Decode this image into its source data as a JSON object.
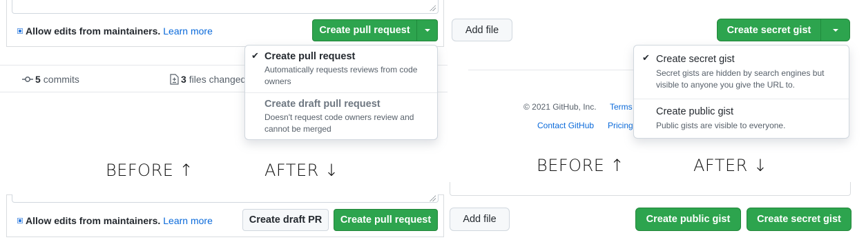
{
  "captions": {
    "left_before": "BEFORE ↑",
    "left_after": "AFTER ↓",
    "right_before": "BEFORE ↑",
    "right_after": "AFTER ↓"
  },
  "pr_before": {
    "allow_edits_label": "Allow edits from maintainers.",
    "learn_more": "Learn more",
    "create_button": "Create pull request",
    "menu": {
      "items": [
        {
          "title": "Create pull request",
          "description": "Automatically requests reviews from code owners",
          "selected": true
        },
        {
          "title": "Create draft pull request",
          "description": "Doesn't request code owners review and cannot be merged",
          "selected": false
        }
      ]
    },
    "stats": {
      "commits_count": "5",
      "commits_label": "commits",
      "files_count": "3",
      "files_label": "files changed"
    }
  },
  "pr_after": {
    "allow_edits_label": "Allow edits from maintainers.",
    "learn_more": "Learn more",
    "draft_button": "Create draft PR",
    "create_button": "Create pull request"
  },
  "gist_before": {
    "add_file": "Add file",
    "create_button": "Create secret gist",
    "menu": {
      "items": [
        {
          "title": "Create secret gist",
          "description": "Secret gists are hidden by search engines but visible to anyone you give the URL to.",
          "selected": true
        },
        {
          "title": "Create public gist",
          "description": "Public gists are visible to everyone.",
          "selected": false
        }
      ]
    },
    "footer": {
      "copyright": "© 2021 GitHub, Inc.",
      "terms": "Terms",
      "contact": "Contact GitHub",
      "pricing": "Pricing"
    }
  },
  "gist_after": {
    "add_file": "Add file",
    "public_button": "Create public gist",
    "secret_button": "Create secret gist"
  },
  "colors": {
    "primary_green": "#2da44e",
    "link_blue": "#0969da"
  },
  "icons": {
    "checkmark": "check-icon",
    "caret": "triangle-down-icon",
    "commit": "git-commit-icon",
    "file_diff": "file-diff-icon"
  }
}
